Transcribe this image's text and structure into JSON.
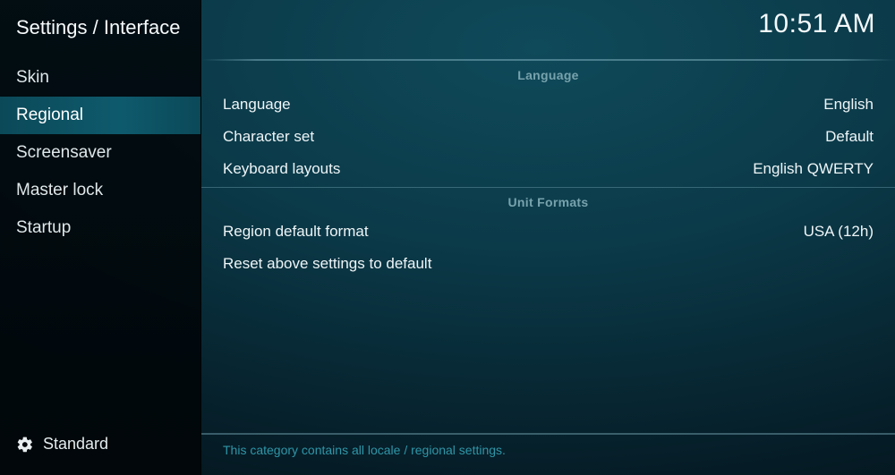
{
  "header": {
    "breadcrumb": "Settings / Interface",
    "clock": "10:51 AM"
  },
  "sidebar": {
    "items": [
      {
        "label": "Skin",
        "selected": false
      },
      {
        "label": "Regional",
        "selected": true
      },
      {
        "label": "Screensaver",
        "selected": false
      },
      {
        "label": "Master lock",
        "selected": false
      },
      {
        "label": "Startup",
        "selected": false
      }
    ],
    "level": "Standard"
  },
  "sections": [
    {
      "title": "Language",
      "rows": [
        {
          "label": "Language",
          "value": "English"
        },
        {
          "label": "Character set",
          "value": "Default"
        },
        {
          "label": "Keyboard layouts",
          "value": "English QWERTY"
        }
      ]
    },
    {
      "title": "Unit Formats",
      "rows": [
        {
          "label": "Region default format",
          "value": "USA (12h)"
        },
        {
          "label": "Reset above settings to default",
          "value": ""
        }
      ]
    }
  ],
  "footer": {
    "description": "This category contains all locale / regional settings."
  }
}
